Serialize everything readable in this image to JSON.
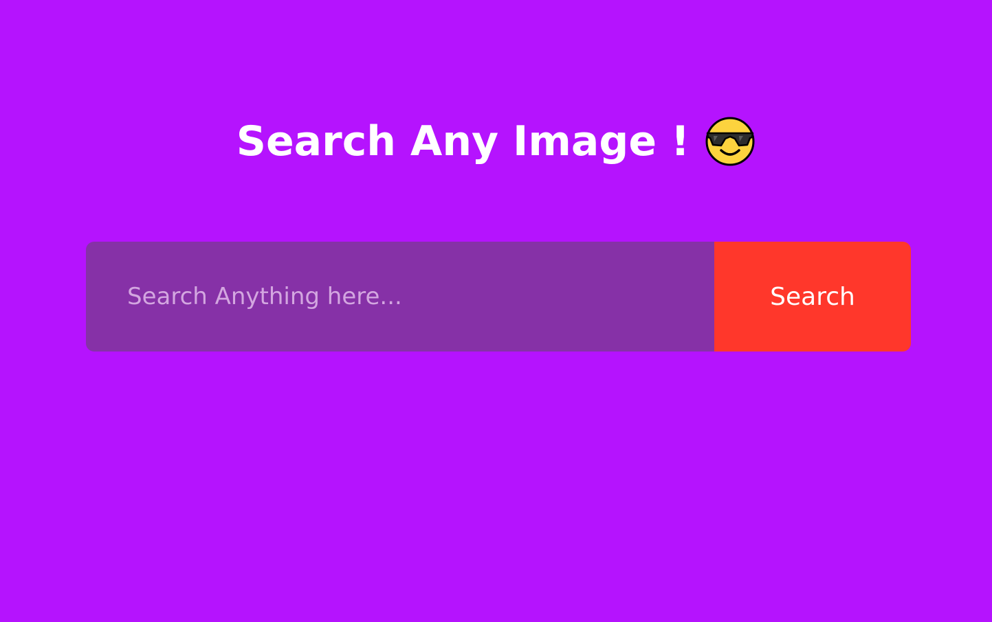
{
  "header": {
    "title": "Search Any Image !",
    "emoji_icon": "smiling-face-with-sunglasses-icon"
  },
  "search": {
    "placeholder": "Search Anything here...",
    "value": "",
    "button_label": "Search"
  },
  "colors": {
    "background": "#b513fe",
    "input_background": "#8631a7",
    "button_background": "#ff372b",
    "title_text": "#ffffff",
    "placeholder_text": "#d3a6e0"
  }
}
